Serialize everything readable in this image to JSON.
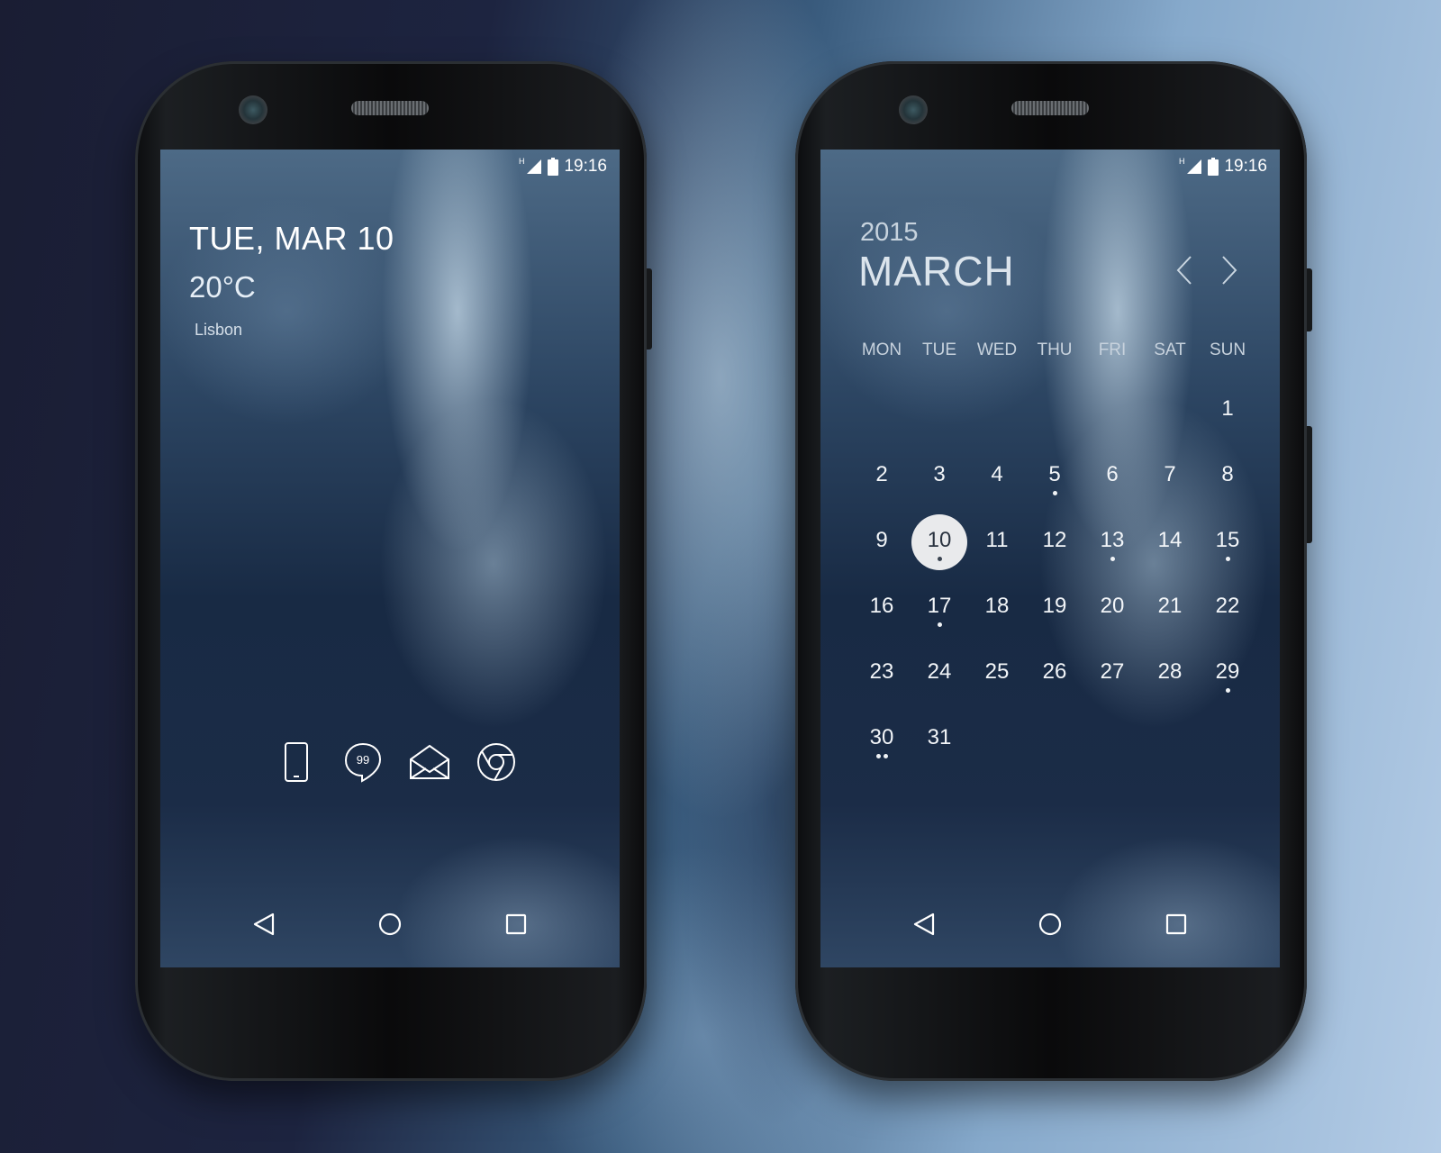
{
  "status_bar": {
    "network_type": "H",
    "time": "19:16"
  },
  "lockscreen": {
    "date": "TUE, MAR 10",
    "temperature": "20°C",
    "city": "Lisbon",
    "dock": [
      {
        "name": "phone-icon"
      },
      {
        "name": "hangouts-icon"
      },
      {
        "name": "email-icon"
      },
      {
        "name": "chrome-icon"
      }
    ]
  },
  "calendar": {
    "year": "2015",
    "month": "MARCH",
    "weekdays": [
      "MON",
      "TUE",
      "WED",
      "THU",
      "FRI",
      "SAT",
      "SUN"
    ],
    "weeks": [
      [
        {
          "d": ""
        },
        {
          "d": ""
        },
        {
          "d": ""
        },
        {
          "d": ""
        },
        {
          "d": ""
        },
        {
          "d": ""
        },
        {
          "d": "1",
          "dots": 0
        }
      ],
      [
        {
          "d": "2",
          "dots": 0
        },
        {
          "d": "3",
          "dots": 0
        },
        {
          "d": "4",
          "dots": 0
        },
        {
          "d": "5",
          "dots": 1
        },
        {
          "d": "6",
          "dots": 0
        },
        {
          "d": "7",
          "dots": 0
        },
        {
          "d": "8",
          "dots": 0
        }
      ],
      [
        {
          "d": "9",
          "dots": 0
        },
        {
          "d": "10",
          "dots": 1,
          "today": true
        },
        {
          "d": "11",
          "dots": 0
        },
        {
          "d": "12",
          "dots": 0
        },
        {
          "d": "13",
          "dots": 1
        },
        {
          "d": "14",
          "dots": 0
        },
        {
          "d": "15",
          "dots": 1
        }
      ],
      [
        {
          "d": "16",
          "dots": 0
        },
        {
          "d": "17",
          "dots": 1
        },
        {
          "d": "18",
          "dots": 0
        },
        {
          "d": "19",
          "dots": 0
        },
        {
          "d": "20",
          "dots": 0
        },
        {
          "d": "21",
          "dots": 0
        },
        {
          "d": "22",
          "dots": 0
        }
      ],
      [
        {
          "d": "23",
          "dots": 0
        },
        {
          "d": "24",
          "dots": 0
        },
        {
          "d": "25",
          "dots": 0
        },
        {
          "d": "26",
          "dots": 0
        },
        {
          "d": "27",
          "dots": 0
        },
        {
          "d": "28",
          "dots": 0
        },
        {
          "d": "29",
          "dots": 1
        }
      ],
      [
        {
          "d": "30",
          "dots": 2
        },
        {
          "d": "31",
          "dots": 0
        },
        {
          "d": ""
        },
        {
          "d": ""
        },
        {
          "d": ""
        },
        {
          "d": ""
        },
        {
          "d": ""
        }
      ]
    ]
  },
  "colors": {
    "text": "#ffffff",
    "today_circle": "#e9eaec",
    "today_text": "#2a3340"
  }
}
